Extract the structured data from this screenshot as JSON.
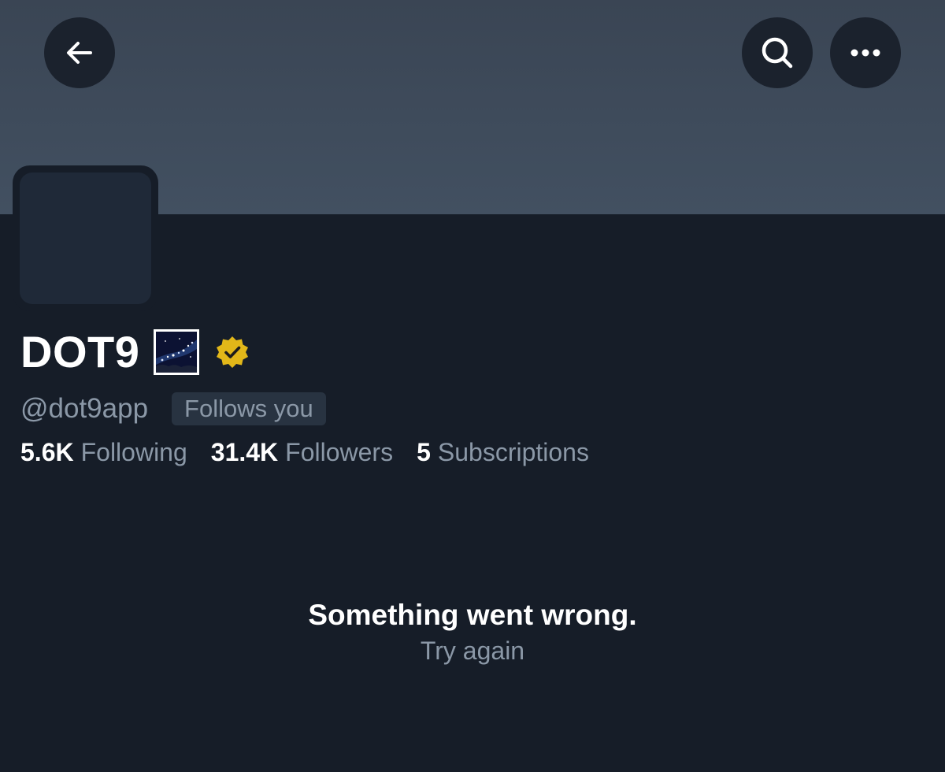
{
  "profile": {
    "display_name": "DOT9",
    "emoji_badge": "milky-way-emoji",
    "verified_badge": "gold-verified-checkmark",
    "handle": "@dot9app",
    "follows_you_label": "Follows you"
  },
  "stats": [
    {
      "value": "5.6K",
      "label": "Following"
    },
    {
      "value": "31.4K",
      "label": "Followers"
    },
    {
      "value": "5",
      "label": "Subscriptions"
    }
  ],
  "error": {
    "title": "Something went wrong.",
    "retry_label": "Try again"
  },
  "icons": {
    "back": "arrow-left-icon",
    "search": "search-icon",
    "more": "more-horizontal-icon"
  },
  "colors": {
    "background": "#161d28",
    "banner": "#3e4a5b",
    "verified_gold": "#e2b719",
    "muted_text": "#8b98a7"
  }
}
